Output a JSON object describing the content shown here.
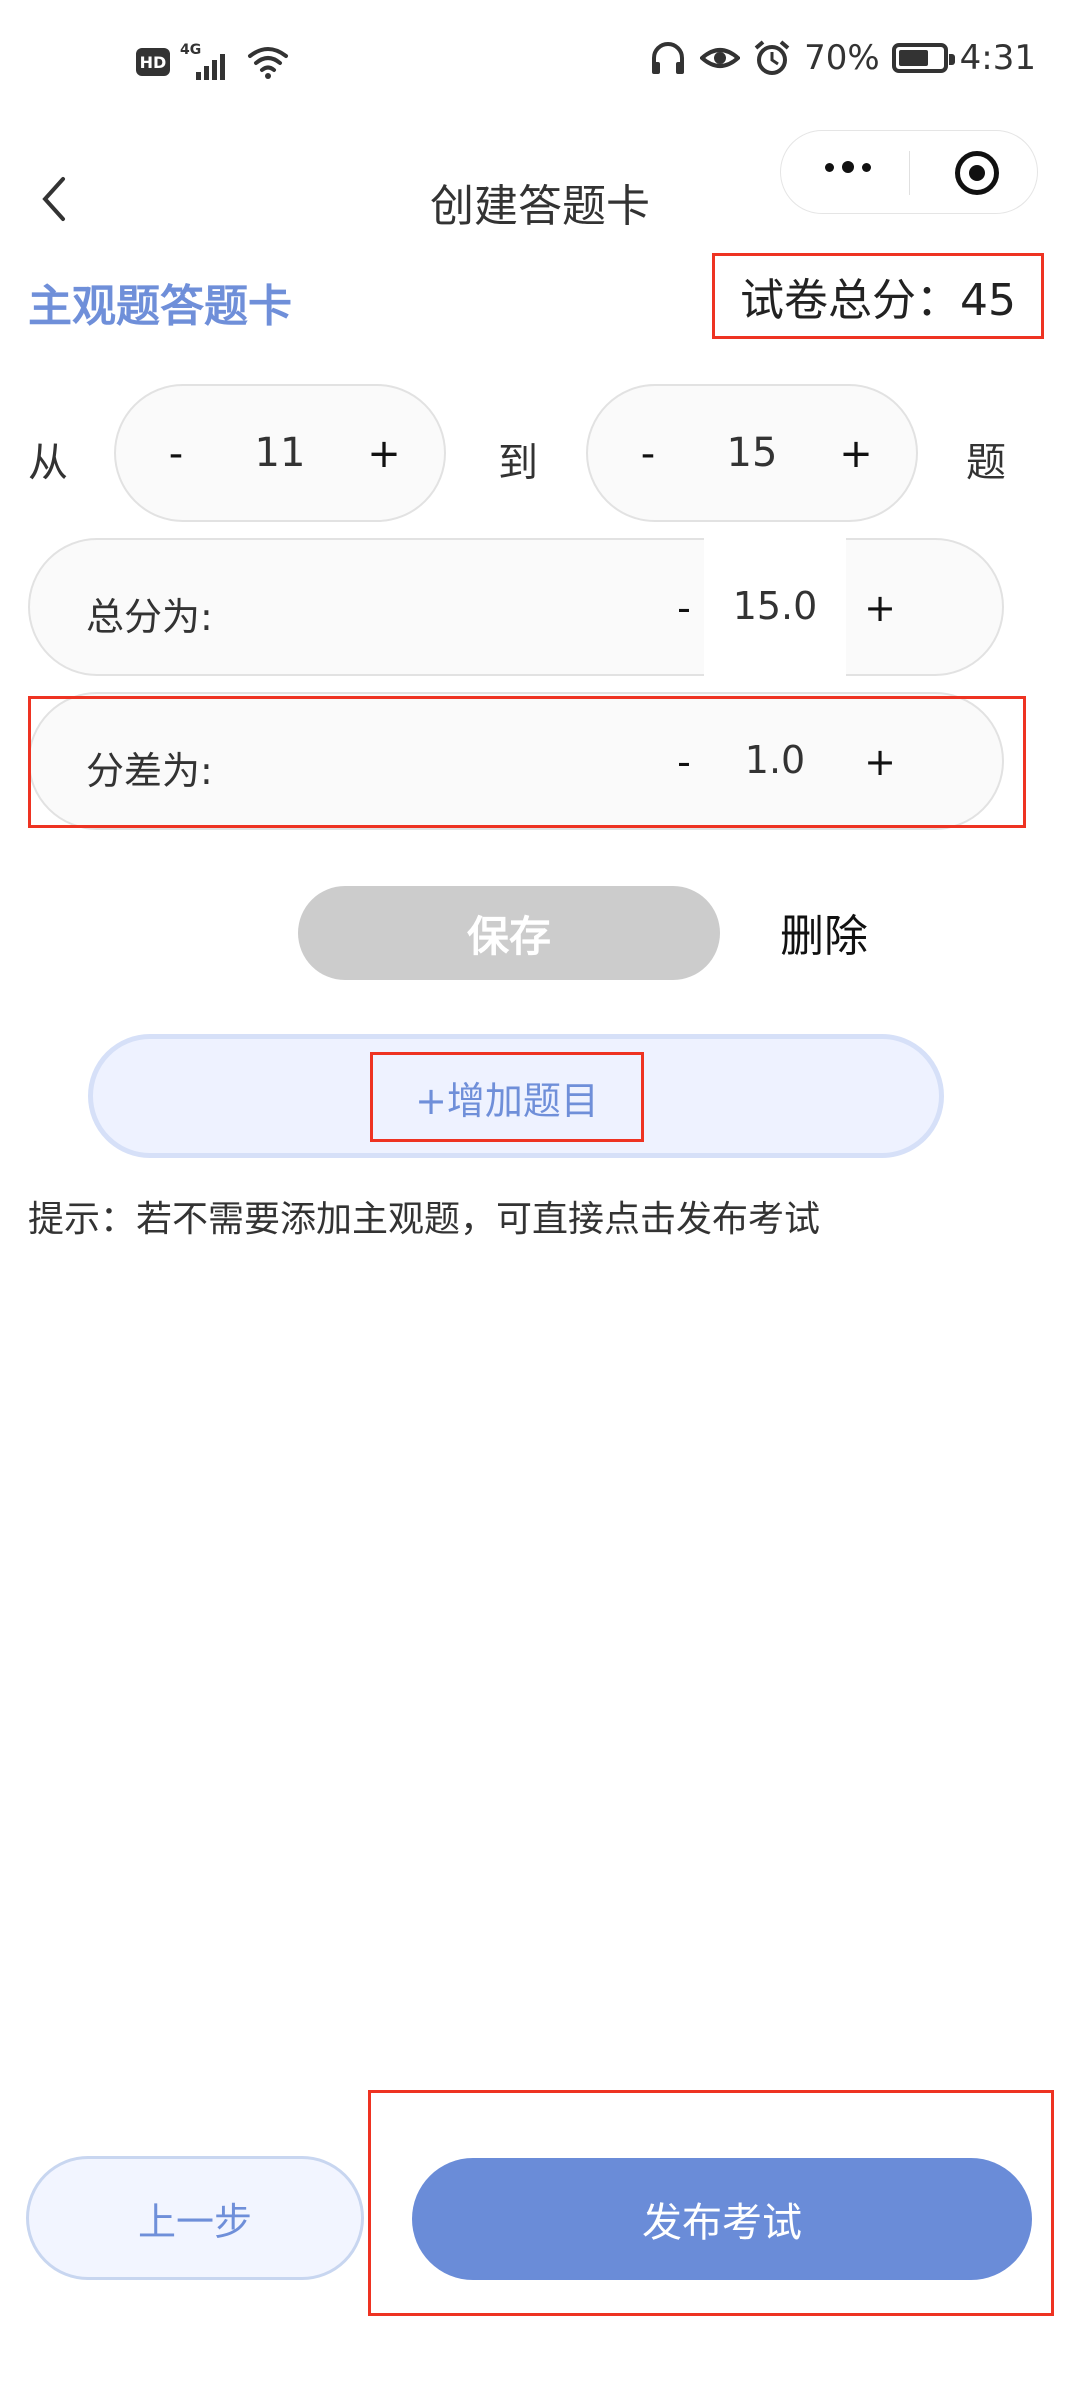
{
  "status_bar": {
    "hd": "HD",
    "network": "4G",
    "battery": "70%",
    "battery_level": 0.7,
    "time": "4:31",
    "icons": [
      "headphones-icon",
      "eye-icon",
      "alarm-icon",
      "wifi-icon",
      "signal-icon",
      "battery-icon"
    ]
  },
  "nav": {
    "title": "创建答题卡",
    "back_icon": "chevron-left-icon",
    "more_icon": "more-dots-icon",
    "target_icon": "target-icon"
  },
  "section": {
    "title": "主观题答题卡",
    "total_score": "试卷总分：45"
  },
  "range": {
    "from_label": "从",
    "to_label": "到",
    "unit_label": "题",
    "from_value": "11",
    "to_value": "15",
    "minus": "-",
    "plus": "+"
  },
  "total_row": {
    "label": "总分为:",
    "value": "15.0",
    "minus": "-",
    "plus": "+"
  },
  "diff_row": {
    "label": "分差为:",
    "value": "1.0",
    "minus": "-",
    "plus": "+"
  },
  "actions": {
    "save": "保存",
    "delete": "删除",
    "add_question": "+增加题目"
  },
  "tip": "提示：若不需要添加主观题，可直接点击发布考试",
  "footer": {
    "prev": "上一步",
    "publish": "发布考试"
  },
  "colors": {
    "accent": "#6a8cd8",
    "highlight": "#ee3322",
    "disabled": "#cccccc"
  }
}
